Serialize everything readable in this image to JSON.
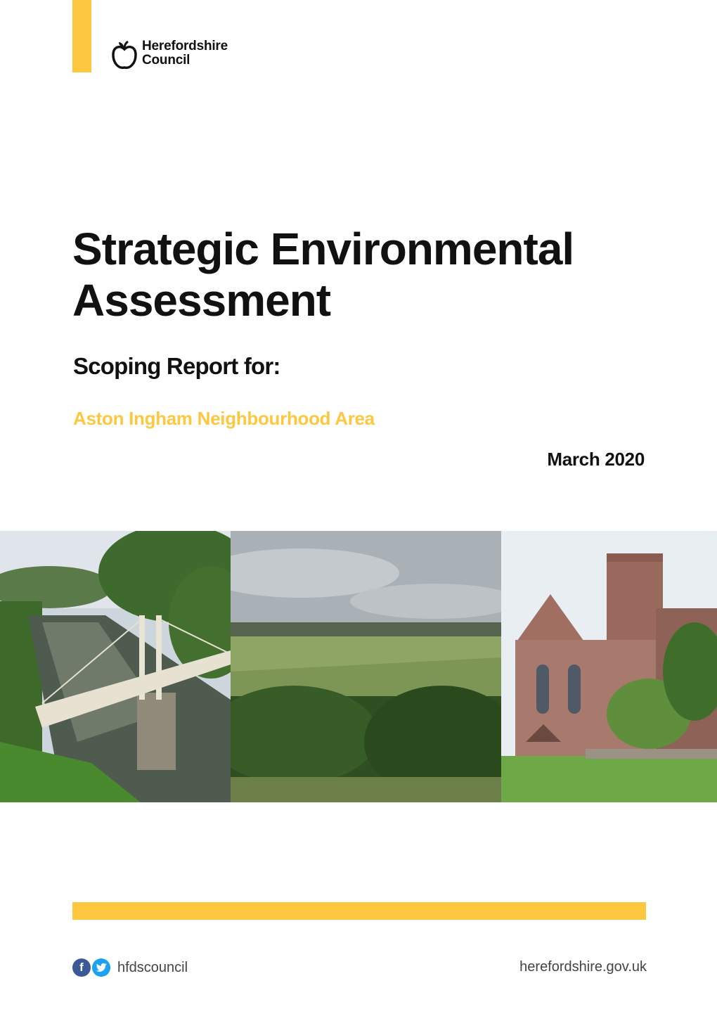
{
  "header": {
    "org_line1": "Herefordshire",
    "org_line2": "Council",
    "logo_icon": "apple-icon",
    "accent_color": "#fdc840"
  },
  "document": {
    "title": "Strategic Environmental Assessment",
    "subtitle": "Scoping Report for:",
    "area": "Aston Ingham Neighbourhood Area",
    "date": "March 2020"
  },
  "photos": [
    {
      "subject": "suspension-bridge-over-river"
    },
    {
      "subject": "rural-landscape-fields"
    },
    {
      "subject": "stone-church-abbey"
    }
  ],
  "footer": {
    "facebook_icon": "facebook-icon",
    "twitter_icon": "twitter-icon",
    "social_handle": "hfdscouncil",
    "website": "herefordshire.gov.uk"
  }
}
